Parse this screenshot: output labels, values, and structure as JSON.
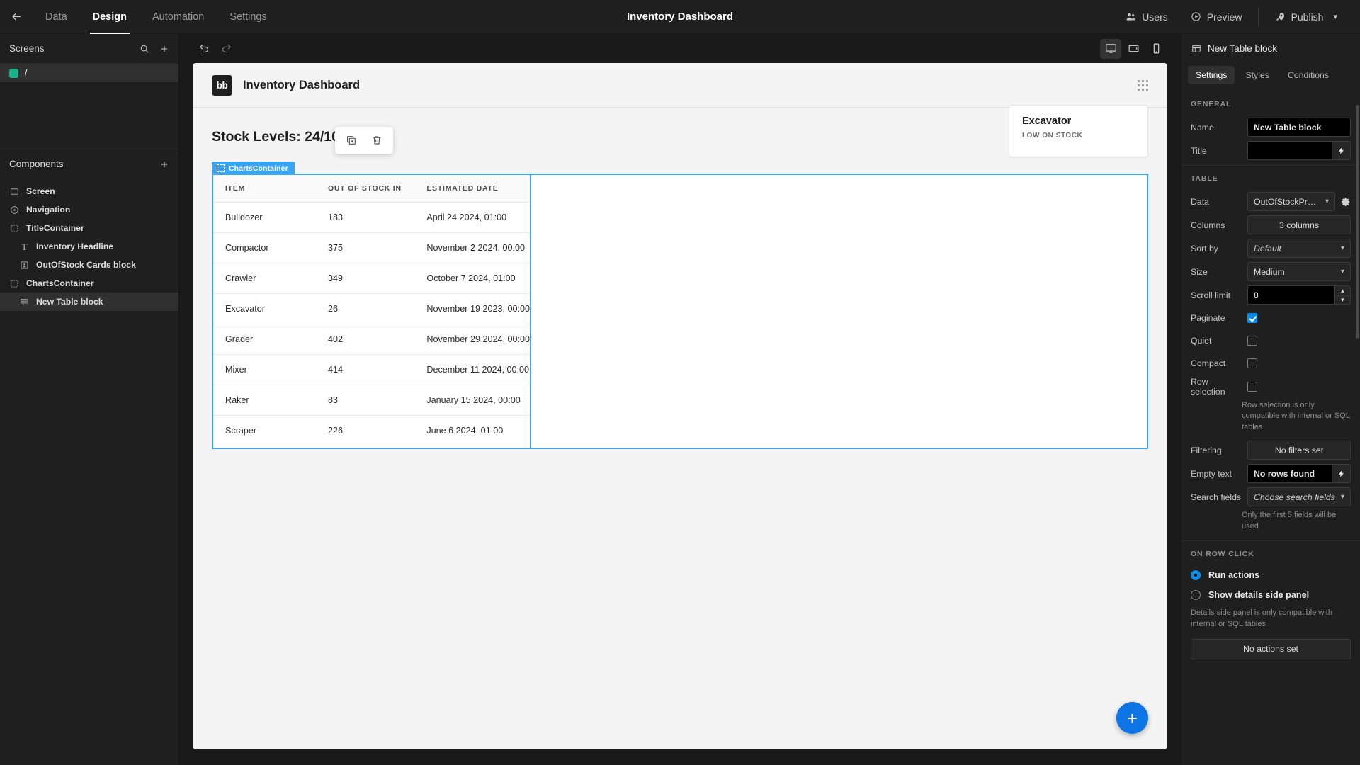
{
  "topbar": {
    "back_icon": "arrow-left-icon",
    "nav": [
      {
        "label": "Data",
        "active": false
      },
      {
        "label": "Design",
        "active": true
      },
      {
        "label": "Automation",
        "active": false
      },
      {
        "label": "Settings",
        "active": false
      }
    ],
    "title": "Inventory Dashboard",
    "users_label": "Users",
    "preview_label": "Preview",
    "publish_label": "Publish"
  },
  "screens_panel": {
    "title": "Screens",
    "search_icon": "search-icon",
    "add_icon": "plus-icon",
    "items": [
      {
        "label": "/",
        "color": "#18b187",
        "selected": true
      }
    ]
  },
  "components_panel": {
    "title": "Components",
    "add_icon": "plus-icon",
    "items": [
      {
        "label": "Screen",
        "icon": "screen-icon",
        "indent": 0,
        "selected": false
      },
      {
        "label": "Navigation",
        "icon": "navigation-icon",
        "indent": 0,
        "selected": false
      },
      {
        "label": "TitleContainer",
        "icon": "container-icon",
        "indent": 0,
        "selected": false
      },
      {
        "label": "Inventory Headline",
        "icon": "text-icon",
        "indent": 1,
        "selected": false
      },
      {
        "label": "OutOfStock Cards block",
        "icon": "card-icon",
        "indent": 1,
        "selected": false
      },
      {
        "label": "ChartsContainer",
        "icon": "container-icon",
        "indent": 0,
        "selected": false
      },
      {
        "label": "New Table block",
        "icon": "table-icon",
        "indent": 1,
        "selected": true
      }
    ]
  },
  "canvas_toolbar": {
    "undo_icon": "undo-icon",
    "redo_icon": "redo-icon",
    "devices": [
      {
        "name": "desktop-icon",
        "active": true
      },
      {
        "name": "tablet-icon",
        "active": false
      },
      {
        "name": "mobile-icon",
        "active": false
      }
    ]
  },
  "preview": {
    "logo_text": "bb",
    "header_title": "Inventory Dashboard",
    "grip_icon": "drag-grip-icon",
    "stock_title": "Stock Levels: 24/10/2023",
    "float_actions": [
      {
        "name": "duplicate-icon"
      },
      {
        "name": "delete-icon"
      }
    ],
    "card": {
      "title": "Excavator",
      "subtitle": "LOW ON STOCK"
    },
    "container_tag": "ChartsContainer",
    "fab_label": "+",
    "table": {
      "columns": [
        "ITEM",
        "OUT OF STOCK IN",
        "ESTIMATED DATE"
      ],
      "rows": [
        [
          "Bulldozer",
          "183",
          "April 24 2024, 01:00"
        ],
        [
          "Compactor",
          "375",
          "November 2 2024, 00:00"
        ],
        [
          "Crawler",
          "349",
          "October 7 2024, 01:00"
        ],
        [
          "Excavator",
          "26",
          "November 19 2023, 00:00"
        ],
        [
          "Grader",
          "402",
          "November 29 2024, 00:00"
        ],
        [
          "Mixer",
          "414",
          "December 11 2024, 00:00"
        ],
        [
          "Raker",
          "83",
          "January 15 2024, 00:00"
        ],
        [
          "Scraper",
          "226",
          "June 6 2024, 01:00"
        ]
      ]
    }
  },
  "settings_panel": {
    "header_title": "New Table block",
    "header_icon": "table-icon",
    "tabs": [
      {
        "label": "Settings",
        "active": true
      },
      {
        "label": "Styles",
        "active": false
      },
      {
        "label": "Conditions",
        "active": false
      }
    ],
    "general_label": "GENERAL",
    "name_label": "Name",
    "name_value": "New Table block",
    "title_label": "Title",
    "title_value": "",
    "table_label": "TABLE",
    "data_label": "Data",
    "data_value": "OutOfStockPr…",
    "columns_label": "Columns",
    "columns_value": "3 columns",
    "sort_by_label": "Sort by",
    "sort_by_value": "Default",
    "size_label": "Size",
    "size_value": "Medium",
    "scroll_limit_label": "Scroll limit",
    "scroll_limit_value": "8",
    "paginate_label": "Paginate",
    "paginate_checked": true,
    "quiet_label": "Quiet",
    "quiet_checked": false,
    "compact_label": "Compact",
    "compact_checked": false,
    "row_selection_label": "Row selection",
    "row_selection_checked": false,
    "row_selection_hint": "Row selection is only compatible with internal or SQL tables",
    "filtering_label": "Filtering",
    "filtering_value": "No filters set",
    "empty_text_label": "Empty text",
    "empty_text_value": "No rows found",
    "search_fields_label": "Search fields",
    "search_fields_placeholder": "Choose search fields",
    "search_fields_hint": "Only the first 5 fields will be used",
    "on_row_click_label": "ON ROW CLICK",
    "run_actions_label": "Run actions",
    "show_details_label": "Show details side panel",
    "on_row_click_selected": "run_actions",
    "details_hint": "Details side panel is only compatible with internal or SQL tables",
    "actions_button": "No actions set"
  },
  "colors": {
    "accent_blue": "#3ba4f2",
    "fab_blue": "#0c74e4",
    "checkbox_blue": "#0c8ce9",
    "screen_green": "#18b187"
  }
}
